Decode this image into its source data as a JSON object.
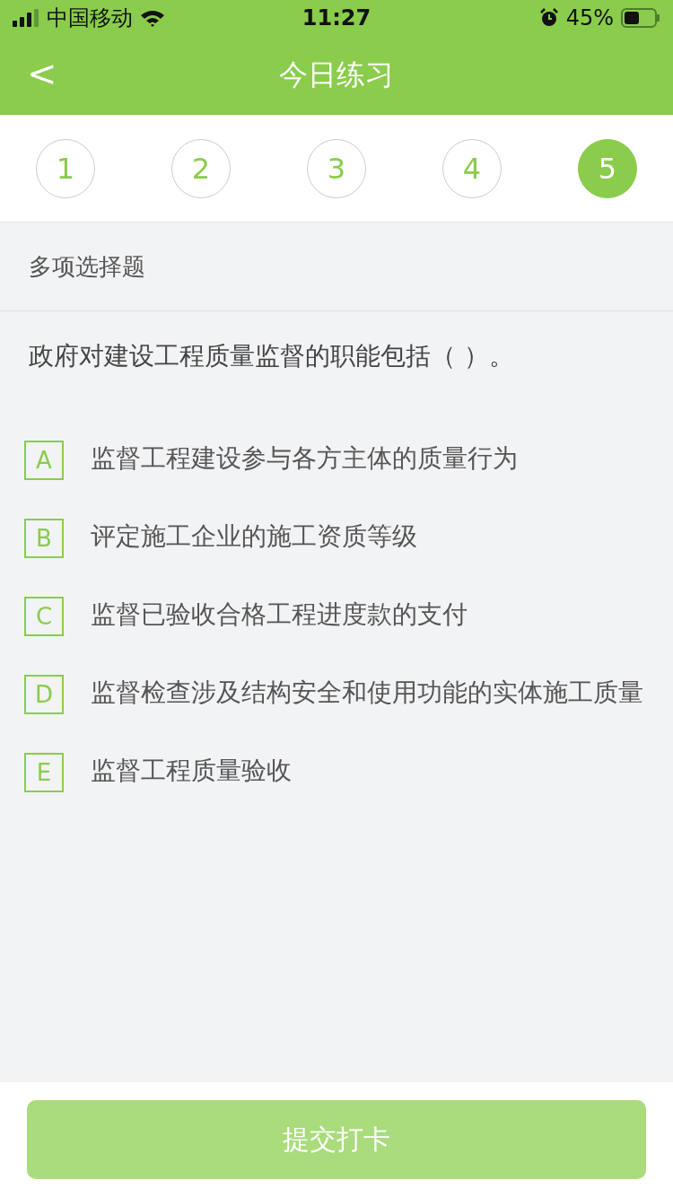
{
  "status_bar": {
    "carrier": "中国移动",
    "time": "11:27",
    "battery": "45%"
  },
  "nav": {
    "back": "<",
    "title": "今日练习"
  },
  "question_tabs": [
    {
      "label": "1",
      "selected": false
    },
    {
      "label": "2",
      "selected": false
    },
    {
      "label": "3",
      "selected": false
    },
    {
      "label": "4",
      "selected": false
    },
    {
      "label": "5",
      "selected": true
    }
  ],
  "question_type": "多项选择题",
  "question": "政府对建设工程质量监督的职能包括（    ）。",
  "options": [
    {
      "letter": "A",
      "text": "监督工程建设参与各方主体的质量行为",
      "checked": false
    },
    {
      "letter": "B",
      "text": "评定施工企业的施工资质等级",
      "checked": false
    },
    {
      "letter": "C",
      "text": "监督已验收合格工程进度款的支付",
      "checked": false
    },
    {
      "letter": "D",
      "text": "监督检查涉及结构安全和使用功能的实体施工质量",
      "checked": false
    },
    {
      "letter": "E",
      "text": "监督工程质量验收",
      "checked": false
    }
  ],
  "submit": {
    "label": "提交打卡",
    "disabled": true
  }
}
